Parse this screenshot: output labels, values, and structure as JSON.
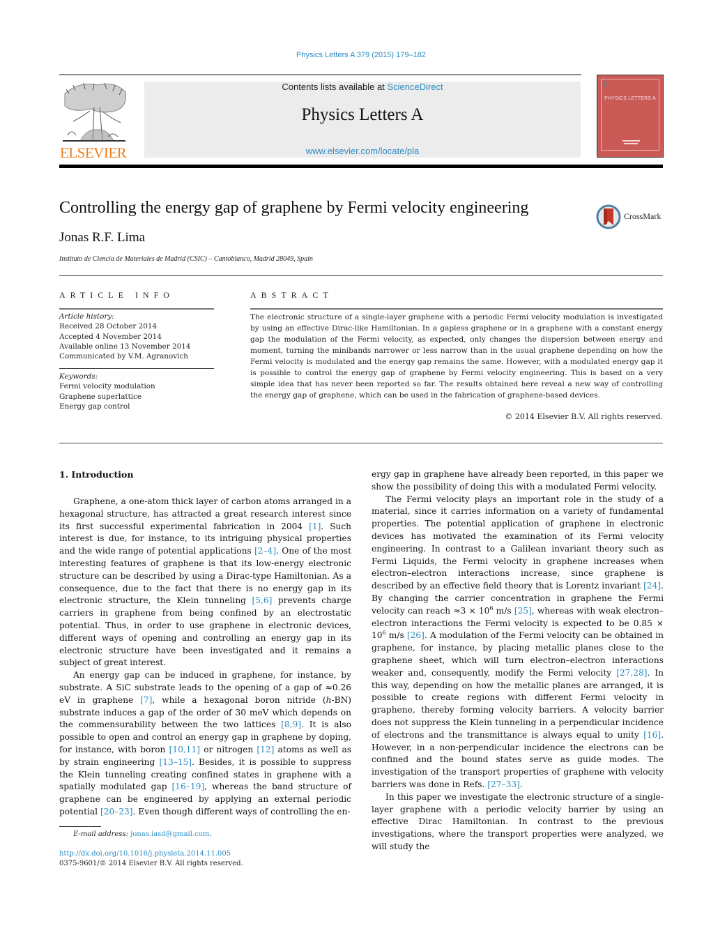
{
  "header": {
    "journal_reference": "Physics Letters A 379 (2015) 179–182",
    "publisher_logo_text": "ELSEVIER",
    "contents_prefix": "Contents lists available at ",
    "contents_link": "ScienceDirect",
    "journal_title": "Physics Letters A",
    "journal_url": "www.elsevier.com/locate/pla",
    "cover_title": "PHYSICS LETTERS A"
  },
  "article": {
    "title": "Controlling the energy gap of graphene by Fermi velocity engineering",
    "crossmark_label": "CrossMark",
    "author": "Jonas R.F. Lima",
    "affiliation": "Instituto de Ciencia de Materiales de Madrid (CSIC) – Cantoblanco, Madrid 28049, Spain"
  },
  "article_info": {
    "heading": "ARTICLE INFO",
    "history_label": "Article history:",
    "history": [
      "Received 28 October 2014",
      "Accepted 4 November 2014",
      "Available online 13 November 2014",
      "Communicated by V.M. Agranovich"
    ],
    "keywords_label": "Keywords:",
    "keywords": [
      "Fermi velocity modulation",
      "Graphene superlattice",
      "Energy gap control"
    ]
  },
  "abstract": {
    "heading": "ABSTRACT",
    "text": "The electronic structure of a single-layer graphene with a periodic Fermi velocity modulation is investigated by using an effective Dirac-like Hamiltonian. In a gapless graphene or in a graphene with a constant energy gap the modulation of the Fermi velocity, as expected, only changes the dispersion between energy and moment, turning the minibands narrower or less narrow than in the usual graphene depending on how the Fermi velocity is modulated and the energy gap remains the same. However, with a modulated energy gap it is possible to control the energy gap of graphene by Fermi velocity engineering. This is based on a very simple idea that has never been reported so far. The results obtained here reveal a new way of controlling the energy gap of graphene, which can be used in the fabrication of graphene-based devices.",
    "copyright": "© 2014 Elsevier B.V. All rights reserved."
  },
  "body": {
    "section_heading": "1. Introduction",
    "left_paragraphs": [
      [
        {
          "t": "Graphene, a one-atom thick layer of carbon atoms arranged in a hexagonal structure, has attracted a great research interest since its first successful experimental fabrication in 2004 "
        },
        {
          "ref": "[1]"
        },
        {
          "t": ". Such interest is due, for instance, to its intriguing physical properties and the wide range of potential applications "
        },
        {
          "ref": "[2–4]"
        },
        {
          "t": ". One of the most interesting features of graphene is that its low-energy electronic structure can be described by using a Dirac-type Hamiltonian. As a consequence, due to the fact that there is no energy gap in its electronic structure, the Klein tunneling "
        },
        {
          "ref": "[5,6]"
        },
        {
          "t": " prevents charge carriers in graphene from being confined by an electrostatic potential. Thus, in order to use graphene in electronic devices, different ways of opening and controlling an energy gap in its electronic structure have been investigated and it remains a subject of great interest."
        }
      ],
      [
        {
          "t": "An energy gap can be induced in graphene, for instance, by substrate. A SiC substrate leads to the opening of a gap of ≈0.26 eV in graphene "
        },
        {
          "ref": "[7]"
        },
        {
          "t": ", while a hexagonal boron nitride ("
        },
        {
          "i": "h"
        },
        {
          "t": "-BN) substrate induces a gap of the order of 30 meV which depends on the commensurability between the two lattices "
        },
        {
          "ref": "[8,9]"
        },
        {
          "t": ". It is also possible to open and control an energy gap in graphene by doping, for instance, with boron "
        },
        {
          "ref": "[10,11]"
        },
        {
          "t": " or nitrogen "
        },
        {
          "ref": "[12]"
        },
        {
          "t": " atoms as well as by strain engineering "
        },
        {
          "ref": "[13–15]"
        },
        {
          "t": ". Besides, it is possible to suppress the Klein tunneling creating confined states in graphene with a spatially modulated gap "
        },
        {
          "ref": "[16–19]"
        },
        {
          "t": ", whereas the band structure of graphene can be engineered by applying an external periodic potential "
        },
        {
          "ref": "[20–23]"
        },
        {
          "t": ". Even though different ways of controlling the en-"
        }
      ]
    ],
    "right_paragraphs": [
      [
        {
          "t": "ergy gap in graphene have already been reported, in this paper we show the possibility of doing this with a modulated Fermi velocity."
        }
      ],
      [
        {
          "t": "The Fermi velocity plays an important role in the study of a material, since it carries information on a variety of fundamental properties. The potential application of graphene in electronic devices has motivated the examination of its Fermi velocity engineering. In contrast to a Galilean invariant theory such as Fermi Liquids, the Fermi velocity in graphene increases when electron–electron interactions increase, since graphene is described by an effective field theory that is Lorentz invariant "
        },
        {
          "ref": "[24]"
        },
        {
          "t": ". By changing the carrier concentration in graphene the Fermi velocity can reach ≈3 × 10"
        },
        {
          "sup": "6"
        },
        {
          "t": " m/s "
        },
        {
          "ref": "[25]"
        },
        {
          "t": ", whereas with weak electron–electron interactions the Fermi velocity is expected to be 0.85 × 10"
        },
        {
          "sup": "6"
        },
        {
          "t": " m/s "
        },
        {
          "ref": "[26]"
        },
        {
          "t": ". A modulation of the Fermi velocity can be obtained in graphene, for instance, by placing metallic planes close to the graphene sheet, which will turn electron–electron interactions weaker and, consequently, modify the Fermi velocity "
        },
        {
          "ref": "[27,28]"
        },
        {
          "t": ". In this way, depending on how the metallic planes are arranged, it is possible to create regions with different Fermi velocity in graphene, thereby forming velocity barriers. A velocity barrier does not suppress the Klein tunneling in a perpendicular incidence of electrons and the transmittance is always equal to unity "
        },
        {
          "ref": "[16]"
        },
        {
          "t": ". However, in a non-perpendicular incidence the electrons can be confined and the bound states serve as guide modes. The investigation of the transport properties of graphene with velocity barriers was done in Refs. "
        },
        {
          "ref": "[27–33]"
        },
        {
          "t": "."
        }
      ],
      [
        {
          "t": "In this paper we investigate the electronic structure of a single-layer graphene with a periodic velocity barrier by using an effective Dirac Hamiltonian. In contrast to the previous investigations, where the transport properties were analyzed, we will study the"
        }
      ]
    ]
  },
  "footer": {
    "email_label": "E-mail address:",
    "email": "jonas.iasd@gmail.com",
    "email_suffix": ".",
    "doi": "http://dx.doi.org/10.1016/j.physleta.2014.11.005",
    "issn_line": "0375-9601/© 2014 Elsevier B.V. All rights reserved."
  }
}
